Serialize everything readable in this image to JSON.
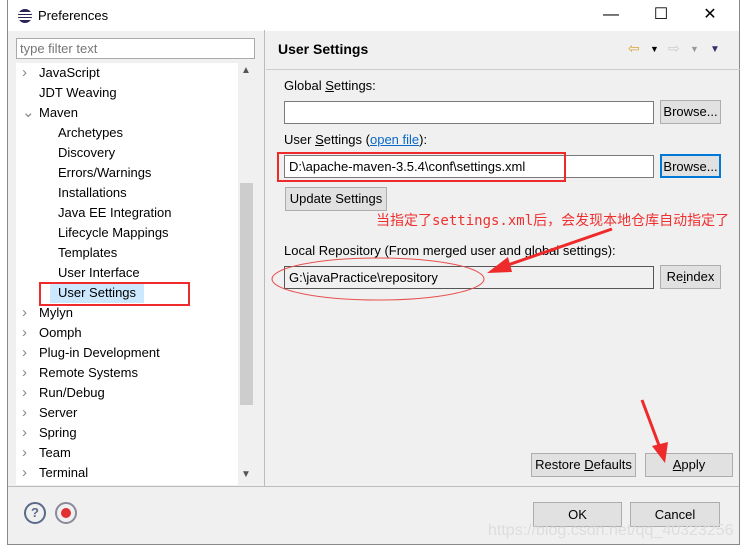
{
  "window": {
    "title": "Preferences",
    "minimize": "—",
    "maximize": "☐",
    "close": "✕"
  },
  "filter": {
    "placeholder": "type filter text"
  },
  "tree": [
    {
      "label": "JavaScript",
      "chevron": ">",
      "indent": 0
    },
    {
      "label": "JDT Weaving",
      "chevron": "",
      "indent": 0
    },
    {
      "label": "Maven",
      "chevron": "v",
      "indent": 0
    },
    {
      "label": "Archetypes",
      "chevron": "",
      "indent": 1
    },
    {
      "label": "Discovery",
      "chevron": "",
      "indent": 1
    },
    {
      "label": "Errors/Warnings",
      "chevron": "",
      "indent": 1
    },
    {
      "label": "Installations",
      "chevron": "",
      "indent": 1
    },
    {
      "label": "Java EE Integration",
      "chevron": "",
      "indent": 1
    },
    {
      "label": "Lifecycle Mappings",
      "chevron": "",
      "indent": 1
    },
    {
      "label": "Templates",
      "chevron": "",
      "indent": 1
    },
    {
      "label": "User Interface",
      "chevron": "",
      "indent": 1
    },
    {
      "label": "User Settings",
      "chevron": "",
      "indent": 1,
      "selected": true
    },
    {
      "label": "Mylyn",
      "chevron": ">",
      "indent": 0
    },
    {
      "label": "Oomph",
      "chevron": ">",
      "indent": 0
    },
    {
      "label": "Plug-in Development",
      "chevron": ">",
      "indent": 0
    },
    {
      "label": "Remote Systems",
      "chevron": ">",
      "indent": 0
    },
    {
      "label": "Run/Debug",
      "chevron": ">",
      "indent": 0
    },
    {
      "label": "Server",
      "chevron": ">",
      "indent": 0
    },
    {
      "label": "Spring",
      "chevron": ">",
      "indent": 0
    },
    {
      "label": "Team",
      "chevron": ">",
      "indent": 0
    },
    {
      "label": "Terminal",
      "chevron": ">",
      "indent": 0
    }
  ],
  "page": {
    "title": "User Settings",
    "global_label_pre": "Global ",
    "global_label_u": "S",
    "global_label_post": "ettings:",
    "global_value": "",
    "browse": "Browse...",
    "user_label_pre": "User ",
    "user_label_u": "S",
    "user_label_mid": "ettings (",
    "open_file": "open file",
    "user_label_post": "):",
    "user_value": "D:\\apache-maven-3.5.4\\conf\\settings.xml",
    "update": "Update Settings",
    "local_label": "Local Repository (From merged user and global settings):",
    "local_value": "G:\\javaPractice\\repository",
    "reindex_pre": "Re",
    "reindex_u": "i",
    "reindex_post": "ndex",
    "restore_pre": "Restore ",
    "restore_u": "D",
    "restore_post": "efaults",
    "apply_u": "A",
    "apply_post": "pply"
  },
  "footer": {
    "ok": "OK",
    "cancel": "Cancel"
  },
  "annotation": {
    "note": "当指定了settings.xml后，会发现本地仓库自动指定了",
    "color": "#ee2a2a"
  },
  "watermark": "https://blog.csdn.net/qq_40323256"
}
